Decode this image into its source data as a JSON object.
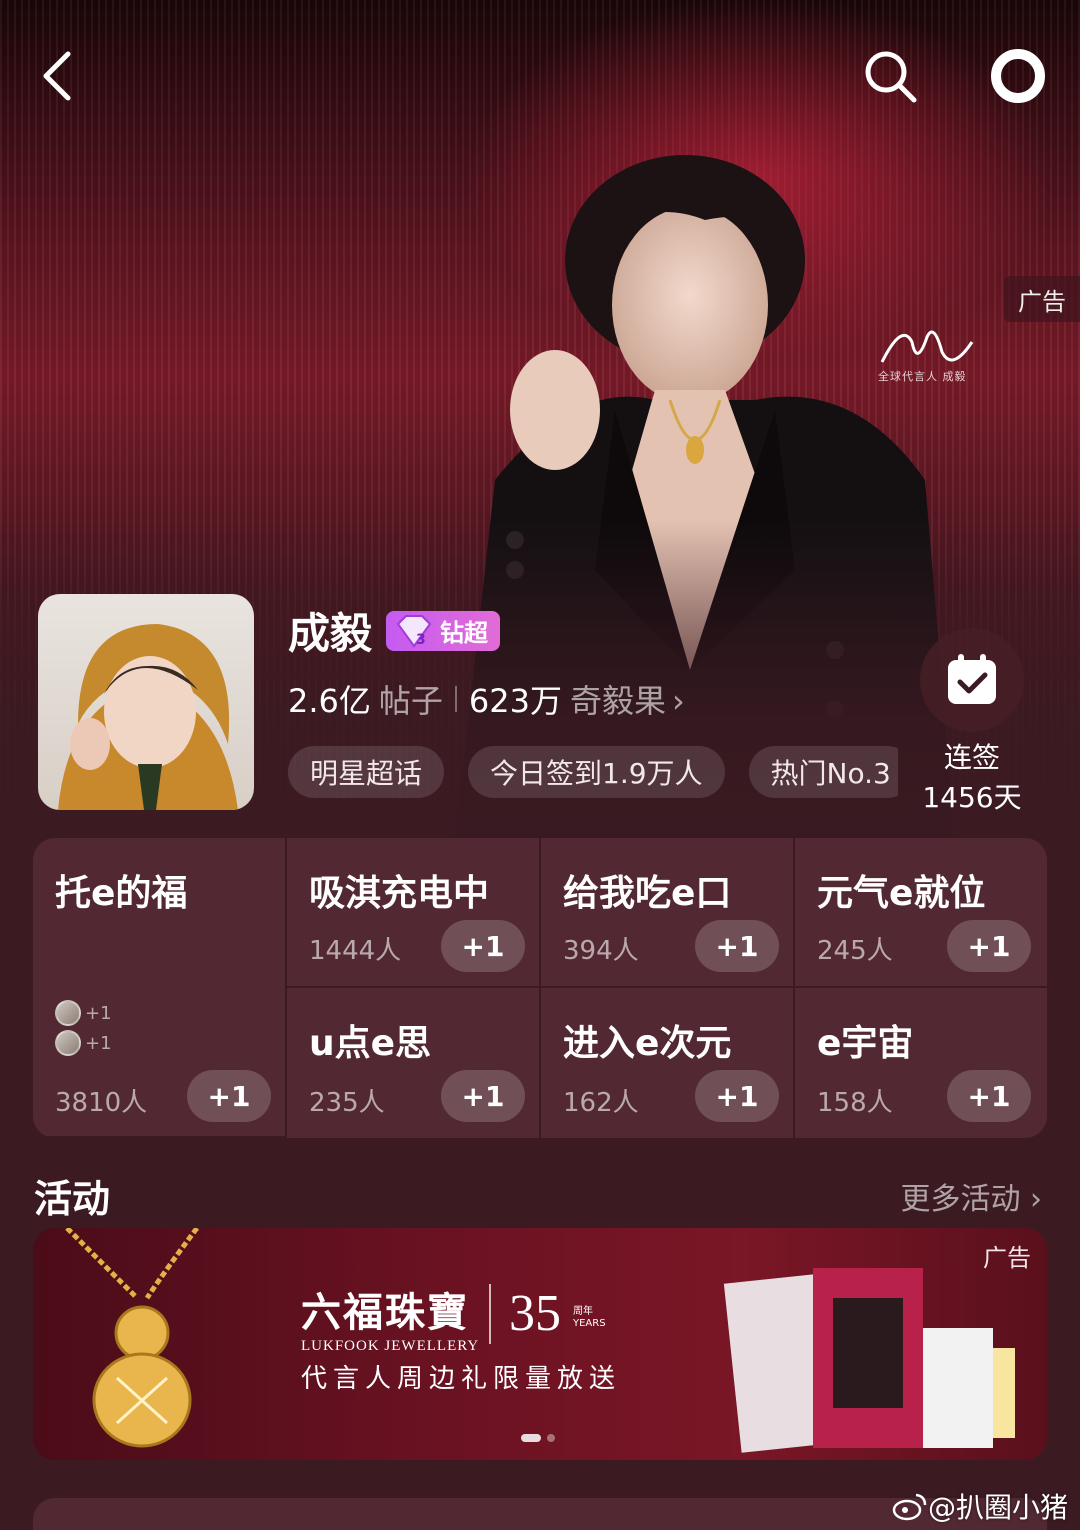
{
  "ad_label": "广告",
  "signature_caption": "全球代言人 成毅",
  "profile": {
    "name": "成毅",
    "badge": "钻超",
    "posts_count": "2.6亿",
    "posts_label": "帖子",
    "fans_count": "623万",
    "fans_label": "奇毅果"
  },
  "chips": [
    "明星超话",
    "今日签到1.9万人",
    "热门No.3"
  ],
  "checkin": {
    "label1": "连签",
    "label2": "1456天"
  },
  "grid": [
    {
      "title": "托e的福",
      "count": "3810人",
      "plus": "+1",
      "mini": [
        "+1",
        "+1"
      ]
    },
    {
      "title": "吸淇充电中",
      "count": "1444人",
      "plus": "+1"
    },
    {
      "title": "给我吃e口",
      "count": "394人",
      "plus": "+1"
    },
    {
      "title": "元气e就位",
      "count": "245人",
      "plus": "+1"
    },
    {
      "title": "u点e思",
      "count": "235人",
      "plus": "+1"
    },
    {
      "title": "进入e次元",
      "count": "162人",
      "plus": "+1"
    },
    {
      "title": "e宇宙",
      "count": "158人",
      "plus": "+1"
    }
  ],
  "activity": {
    "title": "活动",
    "more": "更多活动"
  },
  "banner": {
    "ad": "广告",
    "brand_cn": "六福珠寶",
    "brand_en": "LUKFOOK JEWELLERY",
    "anniversary": "35",
    "years_cn": "周年",
    "years_en": "YEARS",
    "subtitle": "代言人周边礼限量放送"
  },
  "watermark": "@扒圈小猪",
  "colors": {
    "badge": "#c45cf2",
    "background": "#3b1a22",
    "accent_red": "#7a1a28"
  }
}
